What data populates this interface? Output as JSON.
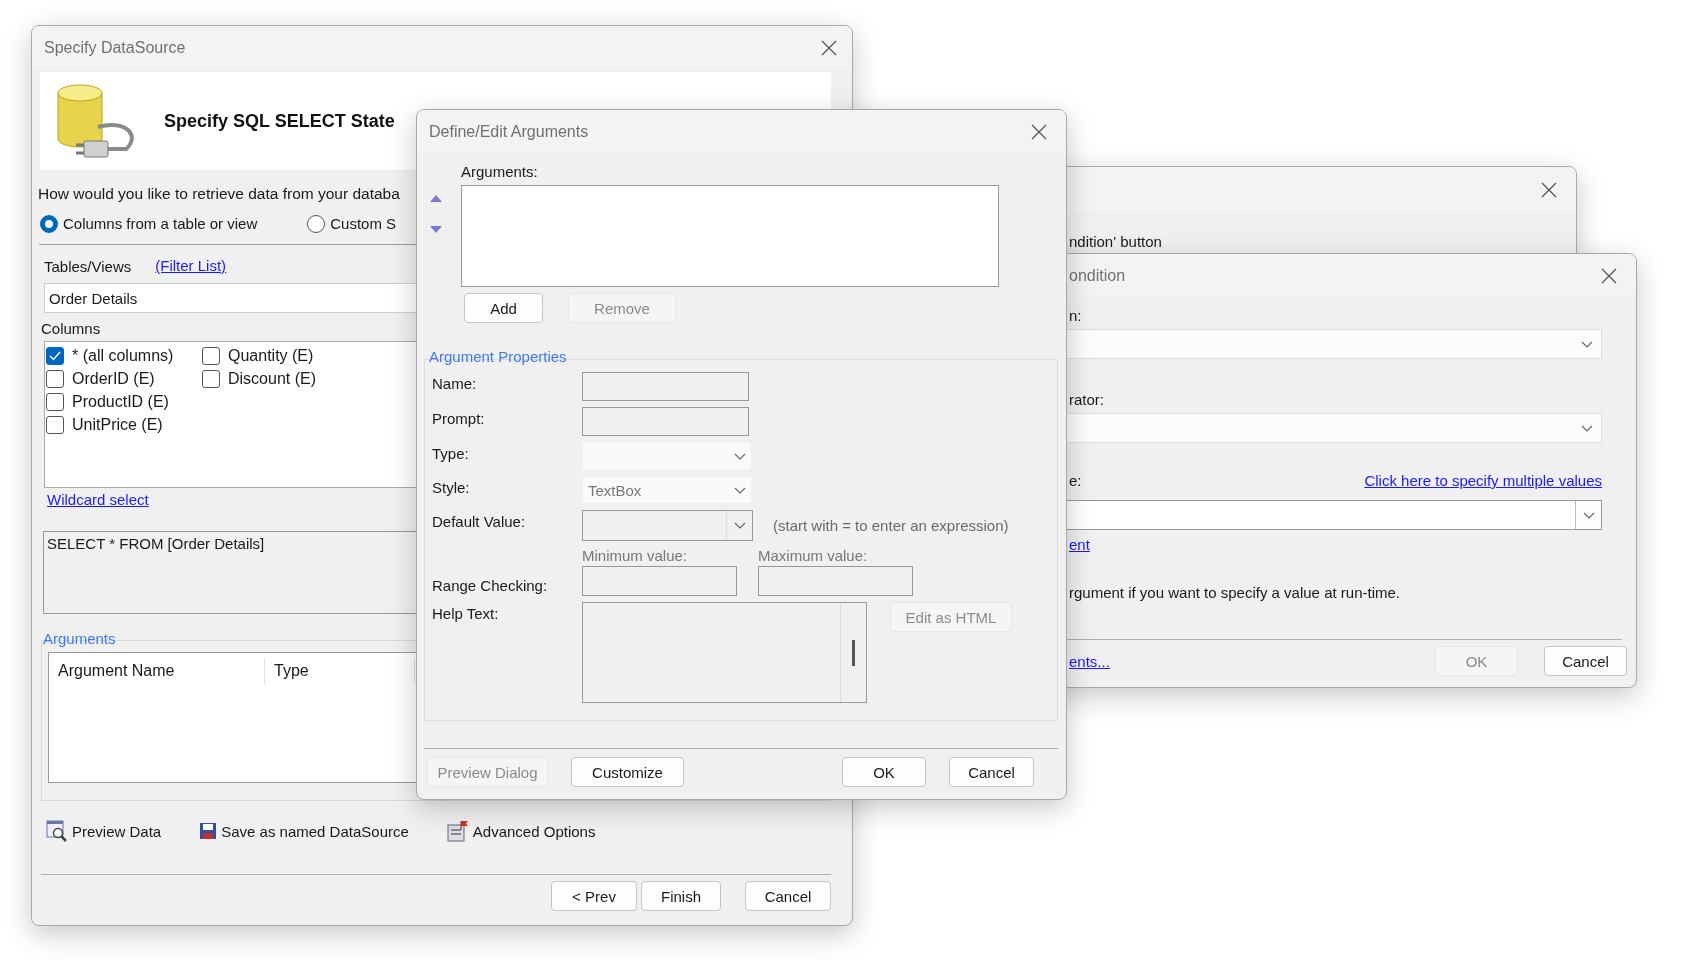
{
  "datasource_dialog": {
    "title": "Specify DataSource",
    "header_title": "Specify SQL SELECT State",
    "question": "How would you like to retrieve data from your databa",
    "retrieve_options": [
      {
        "label": "Columns from a table or view",
        "selected": true
      },
      {
        "label": "Custom S",
        "selected": false
      }
    ],
    "tables_label": "Tables/Views",
    "filter_link": "(Filter List)",
    "table_value": "Order Details",
    "columns_label": "Columns",
    "columns": [
      {
        "label": "* (all columns)",
        "checked": true
      },
      {
        "label": "OrderID (E)",
        "checked": false
      },
      {
        "label": "ProductID (E)",
        "checked": false
      },
      {
        "label": "UnitPrice (E)",
        "checked": false
      },
      {
        "label": "Quantity (E)",
        "checked": false
      },
      {
        "label": "Discount (E)",
        "checked": false
      }
    ],
    "wildcard_link": "Wildcard select",
    "sql_text": "SELECT * FROM [Order Details]",
    "arguments_group": {
      "title": "Arguments",
      "columns": [
        "Argument Name",
        "Type"
      ]
    },
    "actions": [
      {
        "kind": "preview",
        "label": "Preview Data"
      },
      {
        "kind": "save",
        "label": "Save as named DataSource"
      },
      {
        "kind": "options",
        "label": "Advanced Options"
      }
    ],
    "buttons": [
      {
        "label": "< Prev"
      },
      {
        "label": "Finish"
      },
      {
        "label": "Cancel"
      }
    ]
  },
  "arguments_dialog": {
    "title": "Define/Edit Arguments",
    "list_label": "Arguments:",
    "list_buttons": [
      {
        "label": "Add",
        "disabled": false
      },
      {
        "label": "Remove",
        "disabled": true
      }
    ],
    "properties": {
      "title": "Argument Properties",
      "rows": [
        {
          "kind": "text",
          "label": "Name:"
        },
        {
          "kind": "text",
          "label": "Prompt:"
        },
        {
          "kind": "select",
          "label": "Type:"
        },
        {
          "kind": "select",
          "label": "Style:",
          "value": "TextBox"
        },
        {
          "kind": "combo",
          "label": "Default Value:",
          "hint": "(start with = to enter an expression)"
        },
        {
          "kind": "range",
          "label": "Range Checking:",
          "min_label": "Minimum value:",
          "max_label": "Maximum value:"
        },
        {
          "kind": "memo",
          "label": "Help Text:",
          "button": {
            "label": "Edit as HTML",
            "disabled": true
          }
        }
      ]
    },
    "buttons": [
      {
        "label": "Preview Dialog",
        "disabled": true
      },
      {
        "label": "Customize",
        "disabled": false
      },
      {
        "label": "OK",
        "disabled": false
      },
      {
        "label": "Cancel",
        "disabled": false
      }
    ]
  },
  "back_dialog": {
    "text": "ndition' button"
  },
  "condition_dialog": {
    "title": "ondition",
    "fields": [
      {
        "kind": "select",
        "label": "n:"
      },
      {
        "kind": "select",
        "label": "rator:"
      },
      {
        "kind": "combo",
        "label": "e:",
        "link": "Click here to specify multiple values"
      }
    ],
    "argument_link": "ent",
    "hint": "rgument if you want to specify a value at run-time.",
    "footer_link": "ents...",
    "buttons": [
      {
        "label": "OK",
        "disabled": true
      },
      {
        "label": "Cancel",
        "disabled": false
      }
    ]
  }
}
